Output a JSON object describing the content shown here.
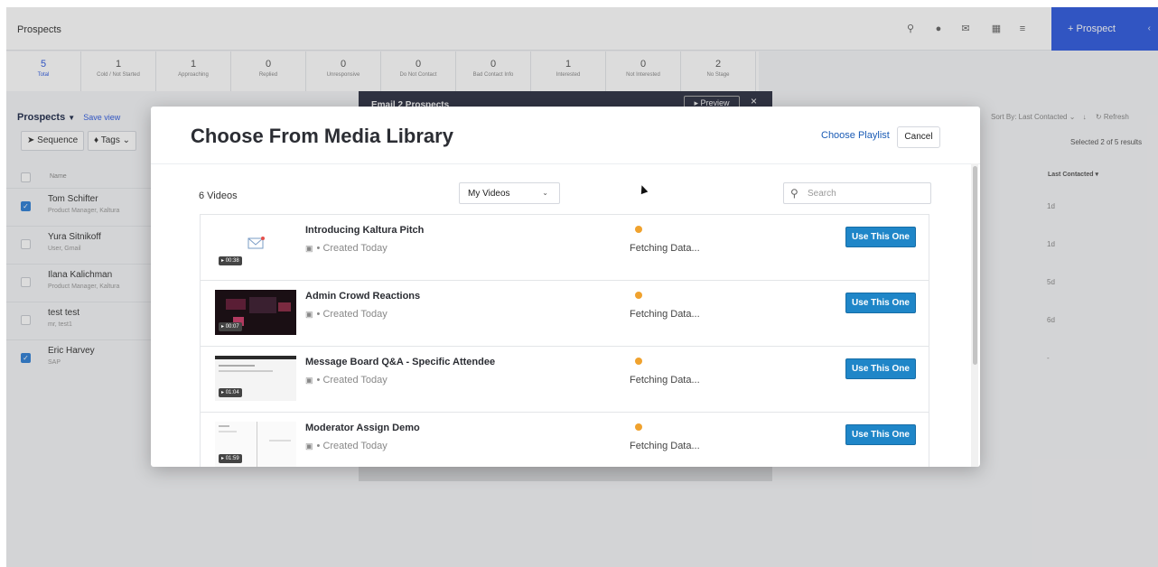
{
  "topbar": {
    "title": "Prospects",
    "icons": [
      "search-icon",
      "help-icon",
      "mail-icon",
      "calendar-icon",
      "bank-icon"
    ],
    "prospect_button": "+ Prospect"
  },
  "stats": [
    {
      "count": "5",
      "label": "Total"
    },
    {
      "count": "1",
      "label": "Cold / Not Started"
    },
    {
      "count": "1",
      "label": "Approaching"
    },
    {
      "count": "0",
      "label": "Replied"
    },
    {
      "count": "0",
      "label": "Unresponsive"
    },
    {
      "count": "0",
      "label": "Do Not Contact"
    },
    {
      "count": "0",
      "label": "Bad Contact Info"
    },
    {
      "count": "1",
      "label": "Interested"
    },
    {
      "count": "0",
      "label": "Not Interested"
    },
    {
      "count": "2",
      "label": "No Stage"
    }
  ],
  "list": {
    "heading": "Prospects",
    "save_view": "Save view",
    "sequence_button": "Sequence",
    "tags_button": "Tags",
    "name_header": "Name",
    "rows": [
      {
        "name": "Tom Schifter",
        "sub": "Product Manager, Kaltura",
        "checked": true,
        "last_contacted": "1d"
      },
      {
        "name": "Yura Sitnikoff",
        "sub": "User, Gmail",
        "checked": false,
        "last_contacted": "1d"
      },
      {
        "name": "Ilana Kalichman",
        "sub": "Product Manager, Kaltura",
        "checked": false,
        "last_contacted": "5d"
      },
      {
        "name": "test test",
        "sub": "mr, test1",
        "checked": false,
        "last_contacted": "6d"
      },
      {
        "name": "Eric Harvey",
        "sub": "SAP",
        "checked": true,
        "last_contacted": "-"
      }
    ]
  },
  "right": {
    "sort_by": "Sort By: Last Contacted",
    "refresh": "Refresh",
    "selected": "Selected 2 of 5 results",
    "last_contacted_header": "Last Contacted"
  },
  "back_modal": {
    "title": "Email 2 Prospects",
    "preview": "Preview"
  },
  "modal": {
    "title": "Choose From Media Library",
    "choose_playlist": "Choose Playlist",
    "cancel": "Cancel",
    "video_count": "6 Videos",
    "filter_value": "My Videos",
    "search_placeholder": "Search",
    "videos": [
      {
        "title": "Introducing Kaltura Pitch",
        "meta": "Created Today",
        "status": "Fetching Data...",
        "duration": "00:38",
        "action": "Use This One"
      },
      {
        "title": "Admin Crowd Reactions",
        "meta": "Created Today",
        "status": "Fetching Data...",
        "duration": "00:07",
        "action": "Use This One"
      },
      {
        "title": "Message Board Q&A - Specific Attendee",
        "meta": "Created Today",
        "status": "Fetching Data...",
        "duration": "01:04",
        "action": "Use This One"
      },
      {
        "title": "Moderator Assign Demo",
        "meta": "Created Today",
        "status": "Fetching Data...",
        "duration": "01:59",
        "action": "Use This One"
      }
    ]
  },
  "colors": {
    "accent": "#2f5be0",
    "use_button": "#1f86c8",
    "status_dot": "#f0a22e",
    "link": "#1a5bb5"
  }
}
